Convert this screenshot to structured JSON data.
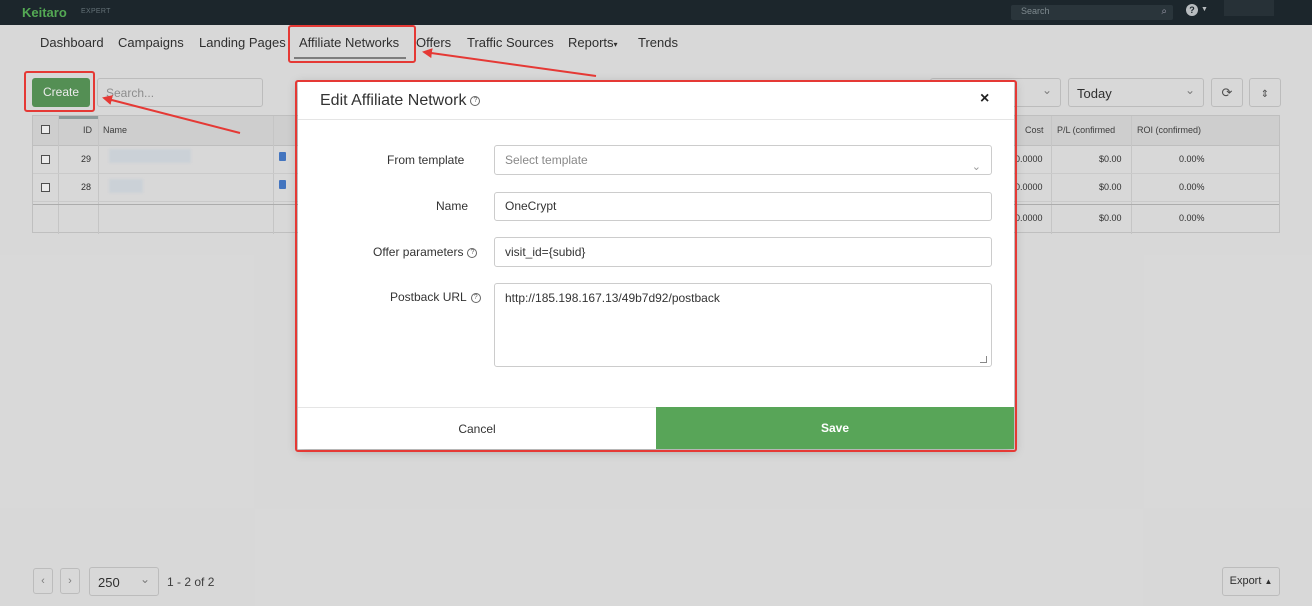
{
  "app": {
    "brand": "Keitaro",
    "edition": "EXPERT"
  },
  "topbar": {
    "search_placeholder": "Search",
    "help_label": "?"
  },
  "nav": {
    "items": [
      "Dashboard",
      "Campaigns",
      "Landing Pages",
      "Affiliate Networks",
      "Offers",
      "Traffic Sources",
      "Reports",
      "Trends"
    ],
    "reports_caret": "▾",
    "active": "Affiliate Networks"
  },
  "toolbar": {
    "create_label": "Create",
    "search_placeholder": "Search...",
    "date_range": "Today"
  },
  "table": {
    "headers": {
      "id": "ID",
      "name": "Name",
      "cost": "Cost",
      "pl": "P/L (confirmed",
      "roi": "ROI (confirmed)"
    },
    "rows": [
      {
        "id": "29",
        "cost": "0.0000",
        "pl": "$0.00",
        "roi": "0.00%"
      },
      {
        "id": "28",
        "cost": "0.0000",
        "pl": "$0.00",
        "roi": "0.00%"
      }
    ],
    "totals": {
      "cost": "0.0000",
      "pl": "$0.00",
      "roi": "0.00%"
    }
  },
  "footer": {
    "page_size": "250",
    "page_info": "1 - 2 of 2",
    "export_label": "Export"
  },
  "modal": {
    "title": "Edit Affiliate Network",
    "close_label": "×",
    "fields": {
      "template_label": "From template",
      "template_placeholder": "Select template",
      "name_label": "Name",
      "name_value": "OneCrypt",
      "offer_params_label": "Offer parameters",
      "offer_params_value": "visit_id={subid}",
      "postback_label": "Postback URL",
      "postback_value": "http://185.198.167.13/49b7d92/postback"
    },
    "cancel_label": "Cancel",
    "save_label": "Save"
  },
  "annotation_color": "#e53935",
  "accent_color": "#58a558"
}
